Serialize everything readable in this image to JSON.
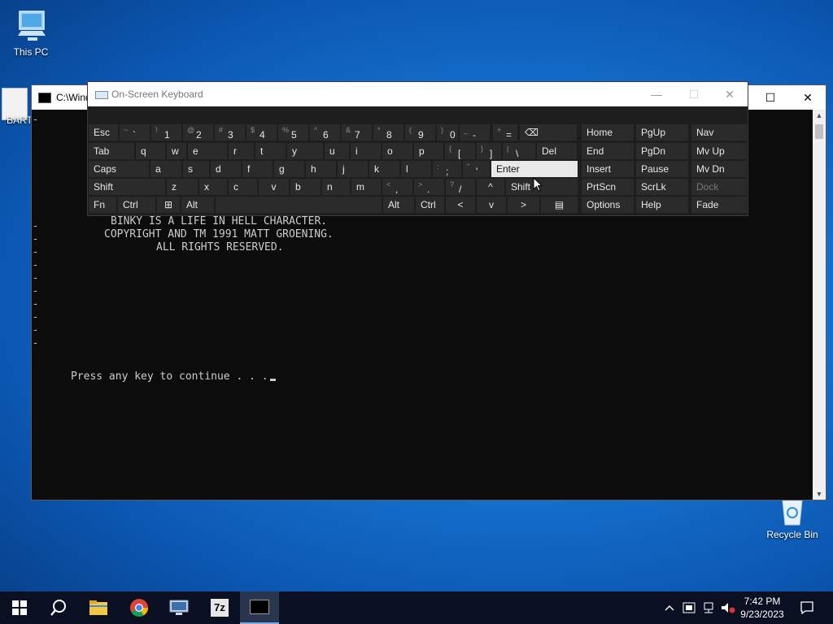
{
  "desktop": {
    "icons": [
      {
        "label": "This PC",
        "icon": "this-pc-icon"
      },
      {
        "label": "BART",
        "icon": "file-icon"
      },
      {
        "label": "Recycle Bin",
        "icon": "recycle-bin-icon"
      }
    ]
  },
  "console": {
    "title": "C:\\Wind",
    "credits": [
      "BINKY IS A LIFE IN HELL CHARACTER.",
      "COPYRIGHT AND TM 1991 MATT GROENING.",
      "ALL RIGHTS RESERVED."
    ],
    "prompt": "Press any key to continue . . .",
    "dash": "-"
  },
  "osk": {
    "title": "On-Screen Keyboard",
    "row1": [
      {
        "label": "Esc"
      },
      {
        "shift": "~",
        "main": "`"
      },
      {
        "shift": "!",
        "main": "1"
      },
      {
        "shift": "@",
        "main": "2"
      },
      {
        "shift": "#",
        "main": "3"
      },
      {
        "shift": "$",
        "main": "4"
      },
      {
        "shift": "%",
        "main": "5"
      },
      {
        "shift": "^",
        "main": "6"
      },
      {
        "shift": "&",
        "main": "7"
      },
      {
        "shift": "*",
        "main": "8"
      },
      {
        "shift": "(",
        "main": "9"
      },
      {
        "shift": ")",
        "main": "0"
      },
      {
        "shift": "_",
        "main": "-"
      },
      {
        "shift": "+",
        "main": "="
      },
      {
        "label": "⌫"
      }
    ],
    "row2": [
      {
        "label": "Tab"
      },
      {
        "label": "q"
      },
      {
        "label": "w"
      },
      {
        "label": "e"
      },
      {
        "label": "r"
      },
      {
        "label": "t"
      },
      {
        "label": "y"
      },
      {
        "label": "u"
      },
      {
        "label": "i"
      },
      {
        "label": "o"
      },
      {
        "label": "p"
      },
      {
        "shift": "{",
        "main": "["
      },
      {
        "shift": "}",
        "main": "]"
      },
      {
        "shift": "|",
        "main": "\\"
      },
      {
        "label": "Del"
      }
    ],
    "row3": [
      {
        "label": "Caps"
      },
      {
        "label": "a"
      },
      {
        "label": "s"
      },
      {
        "label": "d"
      },
      {
        "label": "f"
      },
      {
        "label": "g"
      },
      {
        "label": "h"
      },
      {
        "label": "j"
      },
      {
        "label": "k"
      },
      {
        "label": "l"
      },
      {
        "shift": ":",
        "main": ";"
      },
      {
        "shift": "\"",
        "main": "'"
      },
      {
        "label": "Enter"
      }
    ],
    "row4": [
      {
        "label": "Shift"
      },
      {
        "label": "z"
      },
      {
        "label": "x"
      },
      {
        "label": "c"
      },
      {
        "label": "v"
      },
      {
        "label": "b"
      },
      {
        "label": "n"
      },
      {
        "label": "m"
      },
      {
        "shift": "<",
        "main": ","
      },
      {
        "shift": ">",
        "main": "."
      },
      {
        "shift": "?",
        "main": "/"
      },
      {
        "label": "^"
      },
      {
        "label": "Shift"
      }
    ],
    "row5": [
      {
        "label": "Fn"
      },
      {
        "label": "Ctrl"
      },
      {
        "label": "⊞"
      },
      {
        "label": "Alt"
      },
      {
        "label": ""
      },
      {
        "label": "Alt"
      },
      {
        "label": "Ctrl"
      },
      {
        "label": "<"
      },
      {
        "label": "v"
      },
      {
        "label": ">"
      },
      {
        "label": "▤"
      }
    ],
    "nav": [
      [
        "Home",
        "PgUp",
        "Nav"
      ],
      [
        "End",
        "PgDn",
        "Mv Up"
      ],
      [
        "Insert",
        "Pause",
        "Mv Dn"
      ],
      [
        "PrtScn",
        "ScrLk",
        "Dock"
      ],
      [
        "Options",
        "Help",
        "Fade"
      ]
    ]
  },
  "taskbar": {
    "apps": [
      {
        "name": "start-button",
        "icon": "windows-logo-icon"
      },
      {
        "name": "search-button",
        "icon": "search-icon"
      },
      {
        "name": "file-explorer",
        "icon": "folder-icon"
      },
      {
        "name": "chrome",
        "icon": "chrome-icon"
      },
      {
        "name": "network-app",
        "icon": "monitor-network-icon"
      },
      {
        "name": "7zip",
        "icon": "7zip-icon"
      },
      {
        "name": "console",
        "icon": "console-icon"
      }
    ],
    "sevenzip_label": "7z",
    "time": "7:42 PM",
    "date": "9/23/2023"
  }
}
